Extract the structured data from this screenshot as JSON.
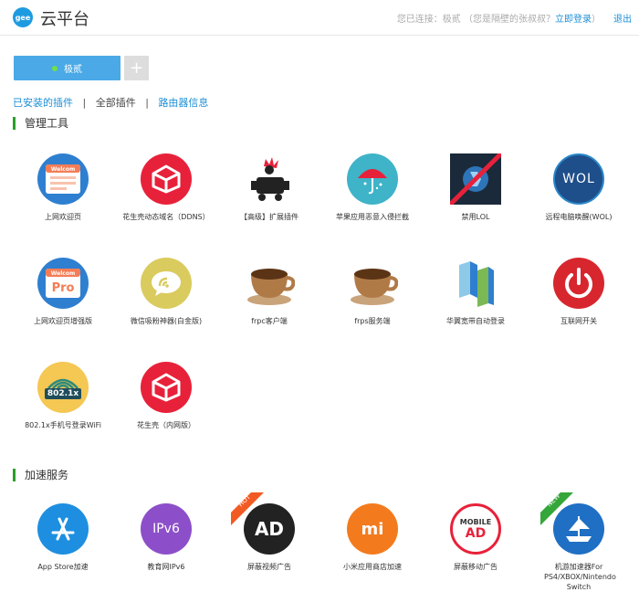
{
  "header": {
    "logo_text": "gee",
    "brand": "云平台",
    "connected_prefix": "您已连接：极贰 （您是隔壁的张叔叔？",
    "login_link": "立即登录",
    "connected_suffix": "）",
    "logout": "退出"
  },
  "router": {
    "name": "极贰",
    "add_symbol": "+"
  },
  "subnav": {
    "installed": "已安装的插件",
    "all": "全部插件",
    "router_info": "路由器信息",
    "sep": "|"
  },
  "sections": {
    "management": "管理工具",
    "acceleration": "加速服务"
  },
  "icon_text": {
    "welcome": "Welcom",
    "pro": "Pro",
    "wol": "WOL",
    "dot1x": "802.1x",
    "ipv6": "IPv6",
    "ad": "AD",
    "mi": "mi",
    "mobile": "MOBILE",
    "hot": "HOT",
    "new": "NEW"
  },
  "management_plugins": [
    {
      "label": "上网欢迎页",
      "icon": "welcome-page-icon"
    },
    {
      "label": "花生壳动态域名（DDNS）",
      "icon": "peanut-shell-icon"
    },
    {
      "label": "【高级】扩展插件",
      "icon": "advanced-extension-icon"
    },
    {
      "label": "苹果应用恶意入侵拦截",
      "icon": "apple-umbrella-icon"
    },
    {
      "label": "禁用LOL",
      "icon": "disable-lol-icon"
    },
    {
      "label": "远程电脑唤醒(WOL)",
      "icon": "wol-icon"
    },
    {
      "label": "上网欢迎页增强版",
      "icon": "welcome-pro-icon"
    },
    {
      "label": "微信吸粉神器(白金版)",
      "icon": "wechat-fans-icon"
    },
    {
      "label": "frpc客户端",
      "icon": "coffee-cup-icon"
    },
    {
      "label": "frps服务端",
      "icon": "coffee-cup-icon"
    },
    {
      "label": "华翼宽带自动登录",
      "icon": "broadband-login-icon"
    },
    {
      "label": "互联网开关",
      "icon": "power-switch-icon"
    },
    {
      "label": "802.1x手机号登录WiFi",
      "icon": "wifi-8021x-icon"
    },
    {
      "label": "花生壳（内网版）",
      "icon": "peanut-shell-icon"
    }
  ],
  "acceleration_plugins": [
    {
      "label": "App Store加速",
      "icon": "app-store-icon"
    },
    {
      "label": "教育网IPv6",
      "icon": "ipv6-icon"
    },
    {
      "label": "屏蔽视频广告",
      "icon": "block-video-ad-icon"
    },
    {
      "label": "小米应用商店加速",
      "icon": "mi-store-icon"
    },
    {
      "label": "屏蔽移动广告",
      "icon": "block-mobile-ad-icon"
    },
    {
      "label": "机游加速器For PS4/XBOX/Nintendo Switch",
      "icon": "game-accelerator-icon"
    }
  ],
  "colors": {
    "accent": "#1e8fd6",
    "router_tab": "#4aa9e6",
    "online_dot": "#6fe04a",
    "section_bar": "#2aa02a",
    "peanut_red": "#e8213a",
    "mi_orange": "#f37b1d",
    "ipv6_purple": "#8c4fc9"
  }
}
